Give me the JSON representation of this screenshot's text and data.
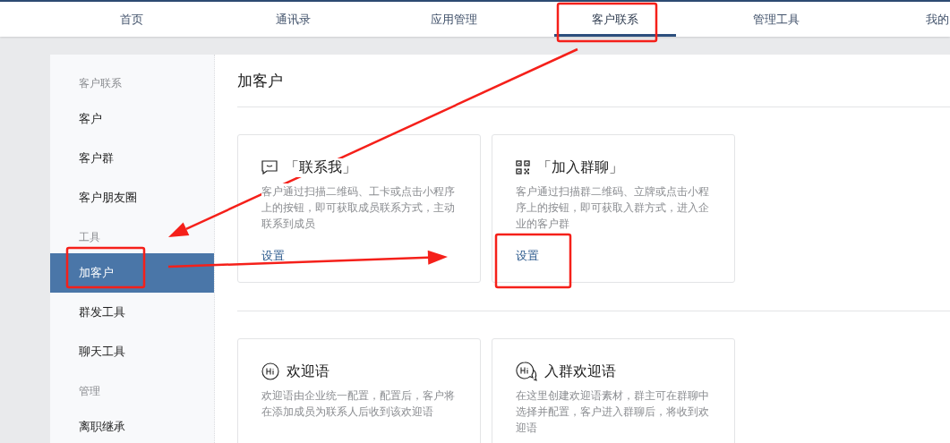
{
  "nav": {
    "tabs": [
      {
        "label": "首页",
        "selected": false
      },
      {
        "label": "通讯录",
        "selected": false
      },
      {
        "label": "应用管理",
        "selected": false
      },
      {
        "label": "客户联系",
        "selected": true
      },
      {
        "label": "管理工具",
        "selected": false
      },
      {
        "label": "我的",
        "selected": false
      }
    ]
  },
  "sidebar": {
    "groups": [
      {
        "title": "客户联系",
        "items": [
          {
            "label": "客户",
            "selected": false
          },
          {
            "label": "客户群",
            "selected": false
          },
          {
            "label": "客户朋友圈",
            "selected": false
          }
        ]
      },
      {
        "title": "工具",
        "items": [
          {
            "label": "加客户",
            "selected": true
          },
          {
            "label": "群发工具",
            "selected": false
          },
          {
            "label": "聊天工具",
            "selected": false
          }
        ]
      },
      {
        "title": "管理",
        "items": [
          {
            "label": "离职继承",
            "selected": false
          }
        ]
      }
    ]
  },
  "main": {
    "title": "加客户",
    "sections": [
      {
        "cards": [
          {
            "kind": "message",
            "title": "「联系我」",
            "description": "客户通过扫描二维码、工卡或点击小程序上的按钮，即可获取成员联系方式，主动联系到成员",
            "link": "设置"
          },
          {
            "kind": "qrcode",
            "title": "「加入群聊」",
            "description": "客户通过扫描群二维码、立牌或点击小程序上的按钮，即可获取入群方式，进入企业的客户群",
            "link": "设置"
          }
        ]
      },
      {
        "cards": [
          {
            "kind": "hi",
            "title": "欢迎语",
            "description": "欢迎语由企业统一配置，配置后，客户将在添加成员为联系人后收到该欢迎语"
          },
          {
            "kind": "hi-chat",
            "title": "入群欢迎语",
            "description": "在这里创建欢迎语素材，群主可在群聊中选择并配置，客户进入群聊后，将收到欢迎语"
          }
        ]
      }
    ]
  },
  "annotations": [
    {
      "kind": "box"
    },
    {
      "kind": "box"
    },
    {
      "kind": "box"
    },
    {
      "kind": "arrow"
    },
    {
      "kind": "arrow"
    }
  ]
}
